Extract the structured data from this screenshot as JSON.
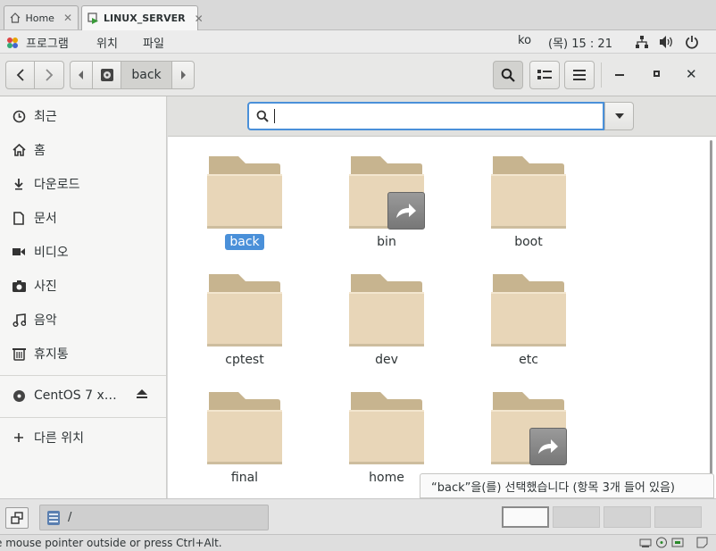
{
  "vm_tabs": [
    {
      "label": "Home",
      "icon": "home-icon"
    },
    {
      "label": "LINUX_SERVER",
      "icon": "vm-icon"
    }
  ],
  "topbar": {
    "menus": [
      "프로그램",
      "위치",
      "파일"
    ],
    "lang": "ko",
    "clock": "(목) 15 : 21"
  },
  "header": {
    "path_segment": "back"
  },
  "sidebar": {
    "items": [
      {
        "label": "최근",
        "icon": "clock-icon"
      },
      {
        "label": "홈",
        "icon": "home-icon"
      },
      {
        "label": "다운로드",
        "icon": "download-icon"
      },
      {
        "label": "문서",
        "icon": "document-icon"
      },
      {
        "label": "비디오",
        "icon": "video-icon"
      },
      {
        "label": "사진",
        "icon": "camera-icon"
      },
      {
        "label": "음악",
        "icon": "music-icon"
      },
      {
        "label": "휴지통",
        "icon": "trash-icon"
      }
    ],
    "device": {
      "label": "CentOS 7 x…",
      "icon": "disc-icon"
    },
    "other": {
      "label": "다른 위치",
      "icon": "plus-icon"
    }
  },
  "search": {
    "value": "",
    "placeholder": ""
  },
  "files": [
    {
      "name": "back",
      "selected": true,
      "link": false
    },
    {
      "name": "bin",
      "selected": false,
      "link": true
    },
    {
      "name": "boot",
      "selected": false,
      "link": false
    },
    {
      "name": "cptest",
      "selected": false,
      "link": false
    },
    {
      "name": "dev",
      "selected": false,
      "link": false
    },
    {
      "name": "etc",
      "selected": false,
      "link": false
    },
    {
      "name": "final",
      "selected": false,
      "link": false
    },
    {
      "name": "home",
      "selected": false,
      "link": false
    },
    {
      "name": "",
      "selected": false,
      "link": true
    }
  ],
  "status": "“back”을(를) 선택했습니다 (항목 3개 들어 있음)",
  "bottombar": {
    "location": "/"
  },
  "vm_status": {
    "message": "e mouse pointer outside or press Ctrl+Alt."
  },
  "colors": {
    "accent": "#4a90d9",
    "folder_body": "#e8d6b8",
    "folder_tab": "#c7b48f"
  }
}
